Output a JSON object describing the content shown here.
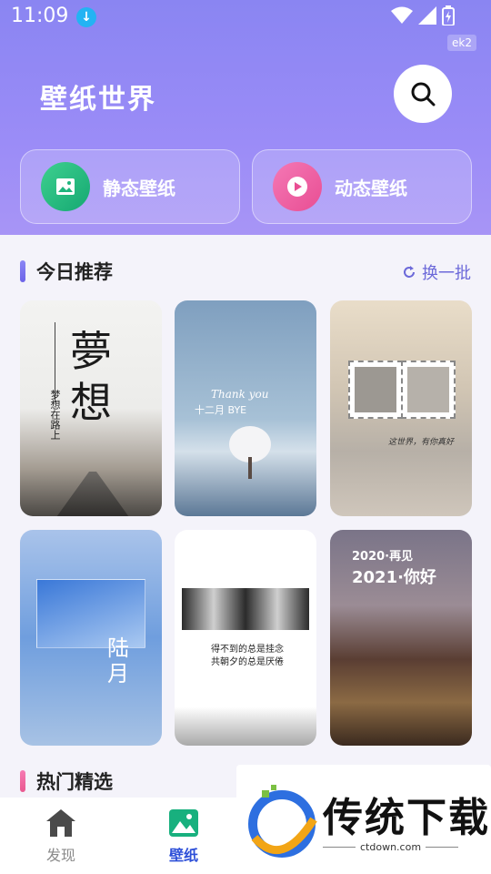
{
  "status": {
    "time": "11:09",
    "tag": "ek2"
  },
  "header": {
    "title": "壁纸世界"
  },
  "categories": [
    {
      "label": "静态壁纸",
      "icon": "image-icon"
    },
    {
      "label": "动态壁纸",
      "icon": "play-icon"
    }
  ],
  "today": {
    "title": "今日推荐",
    "refresh_label": "换一批"
  },
  "wallpapers": [
    {
      "name": "dream-wallpaper",
      "text_big": "夢想",
      "text_small": "梦想在路上"
    },
    {
      "name": "thankyou-wallpaper",
      "text_big": "Thank you",
      "text_small": "十二月 BYE"
    },
    {
      "name": "photo-frame-wallpaper",
      "text_big": "这世界，有你真好",
      "text_small": ""
    },
    {
      "name": "sky-wallpaper",
      "text_big": "陆月",
      "text_small": ""
    },
    {
      "name": "quote-wallpaper",
      "text_big": "得不到的总是挂念",
      "text_small": "共朝夕的总是厌倦"
    },
    {
      "name": "newyear-wallpaper",
      "text_big": "2021·你好",
      "text_small": "2020·再见"
    }
  ],
  "hot": {
    "title": "热门精选"
  },
  "tabs": [
    {
      "label": "发现",
      "icon": "home-icon"
    },
    {
      "label": "壁纸",
      "icon": "wallpaper-icon"
    }
  ],
  "watermark": {
    "text": "传统下载",
    "url": "ctdown.com"
  },
  "colors": {
    "accent": "#6c69d9",
    "header_top": "#8a85f2",
    "tab_active": "#2d4fd8"
  }
}
